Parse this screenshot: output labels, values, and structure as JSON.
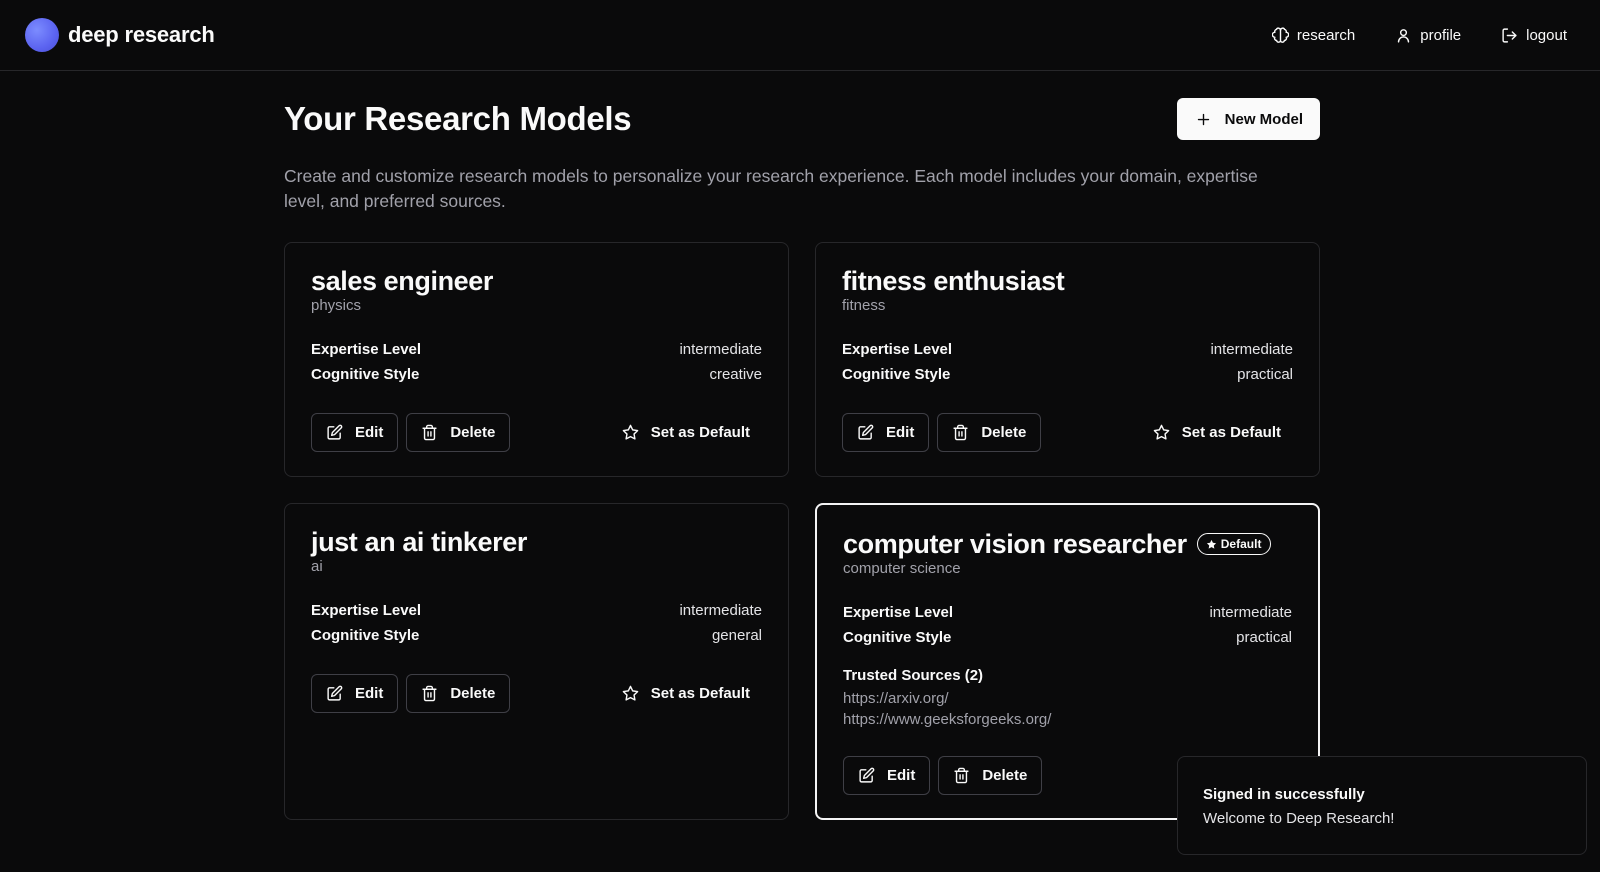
{
  "header": {
    "brand": "deep research",
    "nav": [
      {
        "label": "research",
        "icon": "brain-icon"
      },
      {
        "label": "profile",
        "icon": "user-icon"
      },
      {
        "label": "logout",
        "icon": "logout-icon"
      }
    ]
  },
  "page": {
    "title": "Your Research Models",
    "new_button": "New Model",
    "description": "Create and customize research models to personalize your research experience. Each model includes your domain, expertise level, and preferred sources."
  },
  "labels": {
    "expertise": "Expertise Level",
    "cognitive": "Cognitive Style",
    "edit": "Edit",
    "delete": "Delete",
    "set_default": "Set as Default",
    "default_badge": "Default"
  },
  "models": [
    {
      "name": "sales engineer",
      "domain": "physics",
      "expertise": "intermediate",
      "cognitive": "creative"
    },
    {
      "name": "fitness enthusiast",
      "domain": "fitness",
      "expertise": "intermediate",
      "cognitive": "practical"
    },
    {
      "name": "just an ai tinkerer",
      "domain": "ai",
      "expertise": "intermediate",
      "cognitive": "general"
    },
    {
      "name": "computer vision researcher",
      "domain": "computer science",
      "expertise": "intermediate",
      "cognitive": "practical",
      "is_default": true,
      "sources_heading": "Trusted Sources (2)",
      "sources": [
        "https://arxiv.org/",
        "https://www.geeksforgeeks.org/"
      ]
    }
  ],
  "toast": {
    "title": "Signed in successfully",
    "message": "Welcome to Deep Research!"
  },
  "colors": {
    "background": "#0a0a0b",
    "border": "#27272a",
    "text": "#fafafa",
    "muted": "#a1a1aa",
    "brand_logo": "#5b63f0"
  }
}
